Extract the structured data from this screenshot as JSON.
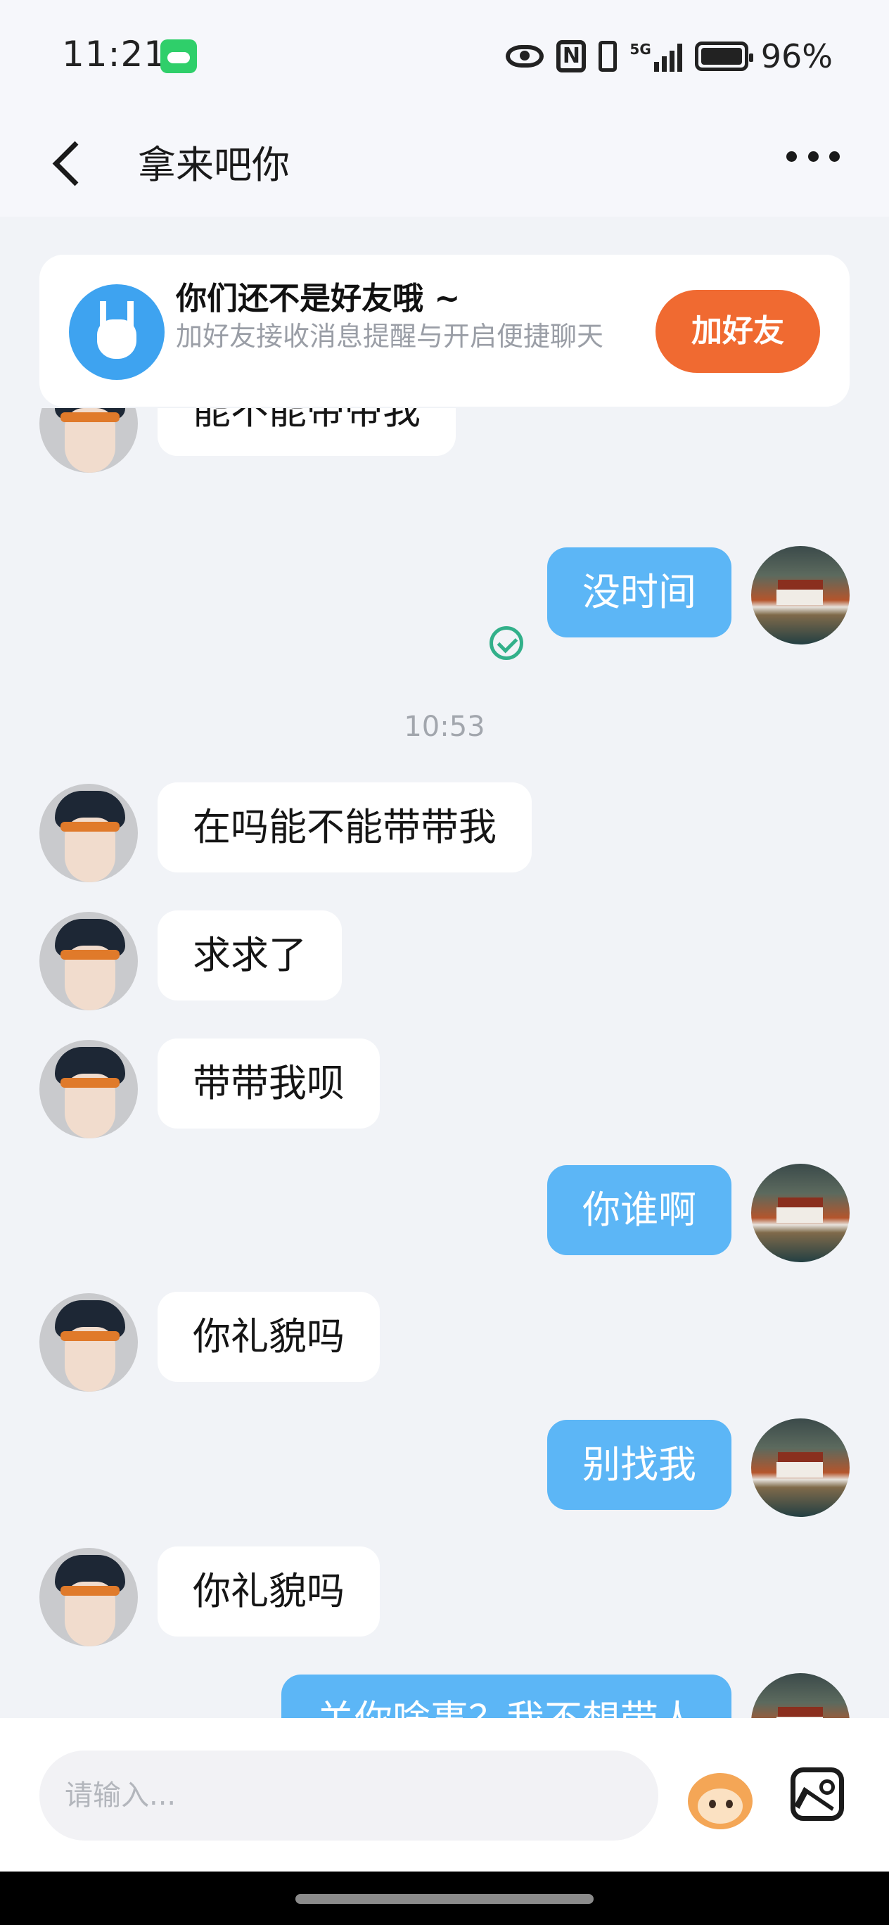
{
  "status_bar": {
    "time": "11:21",
    "battery": "96%",
    "network": "5G"
  },
  "header": {
    "title": "拿来吧你"
  },
  "friend_banner": {
    "title": "你们还不是好友哦 ~",
    "subtitle": "加好友接收消息提醒与开启便捷聊天",
    "button": "加好友"
  },
  "messages": [
    {
      "sender": "them",
      "text": "能不能带带我"
    },
    {
      "sender": "me",
      "text": "没时间",
      "status": "read"
    },
    {
      "type": "timestamp",
      "text": "10:53"
    },
    {
      "sender": "them",
      "text": "在吗能不能带带我"
    },
    {
      "sender": "them",
      "text": "求求了"
    },
    {
      "sender": "them",
      "text": "带带我呗"
    },
    {
      "sender": "me",
      "text": "你谁啊"
    },
    {
      "sender": "them",
      "text": "你礼貌吗"
    },
    {
      "sender": "me",
      "text": "别找我"
    },
    {
      "sender": "them",
      "text": "你礼貌吗"
    },
    {
      "sender": "me",
      "text": "关你啥事？我不想带人"
    }
  ],
  "input": {
    "placeholder": "请输入..."
  },
  "colors": {
    "accent": "#5cb6f6",
    "add_button": "#f06a31",
    "read_check": "#32b08a"
  }
}
